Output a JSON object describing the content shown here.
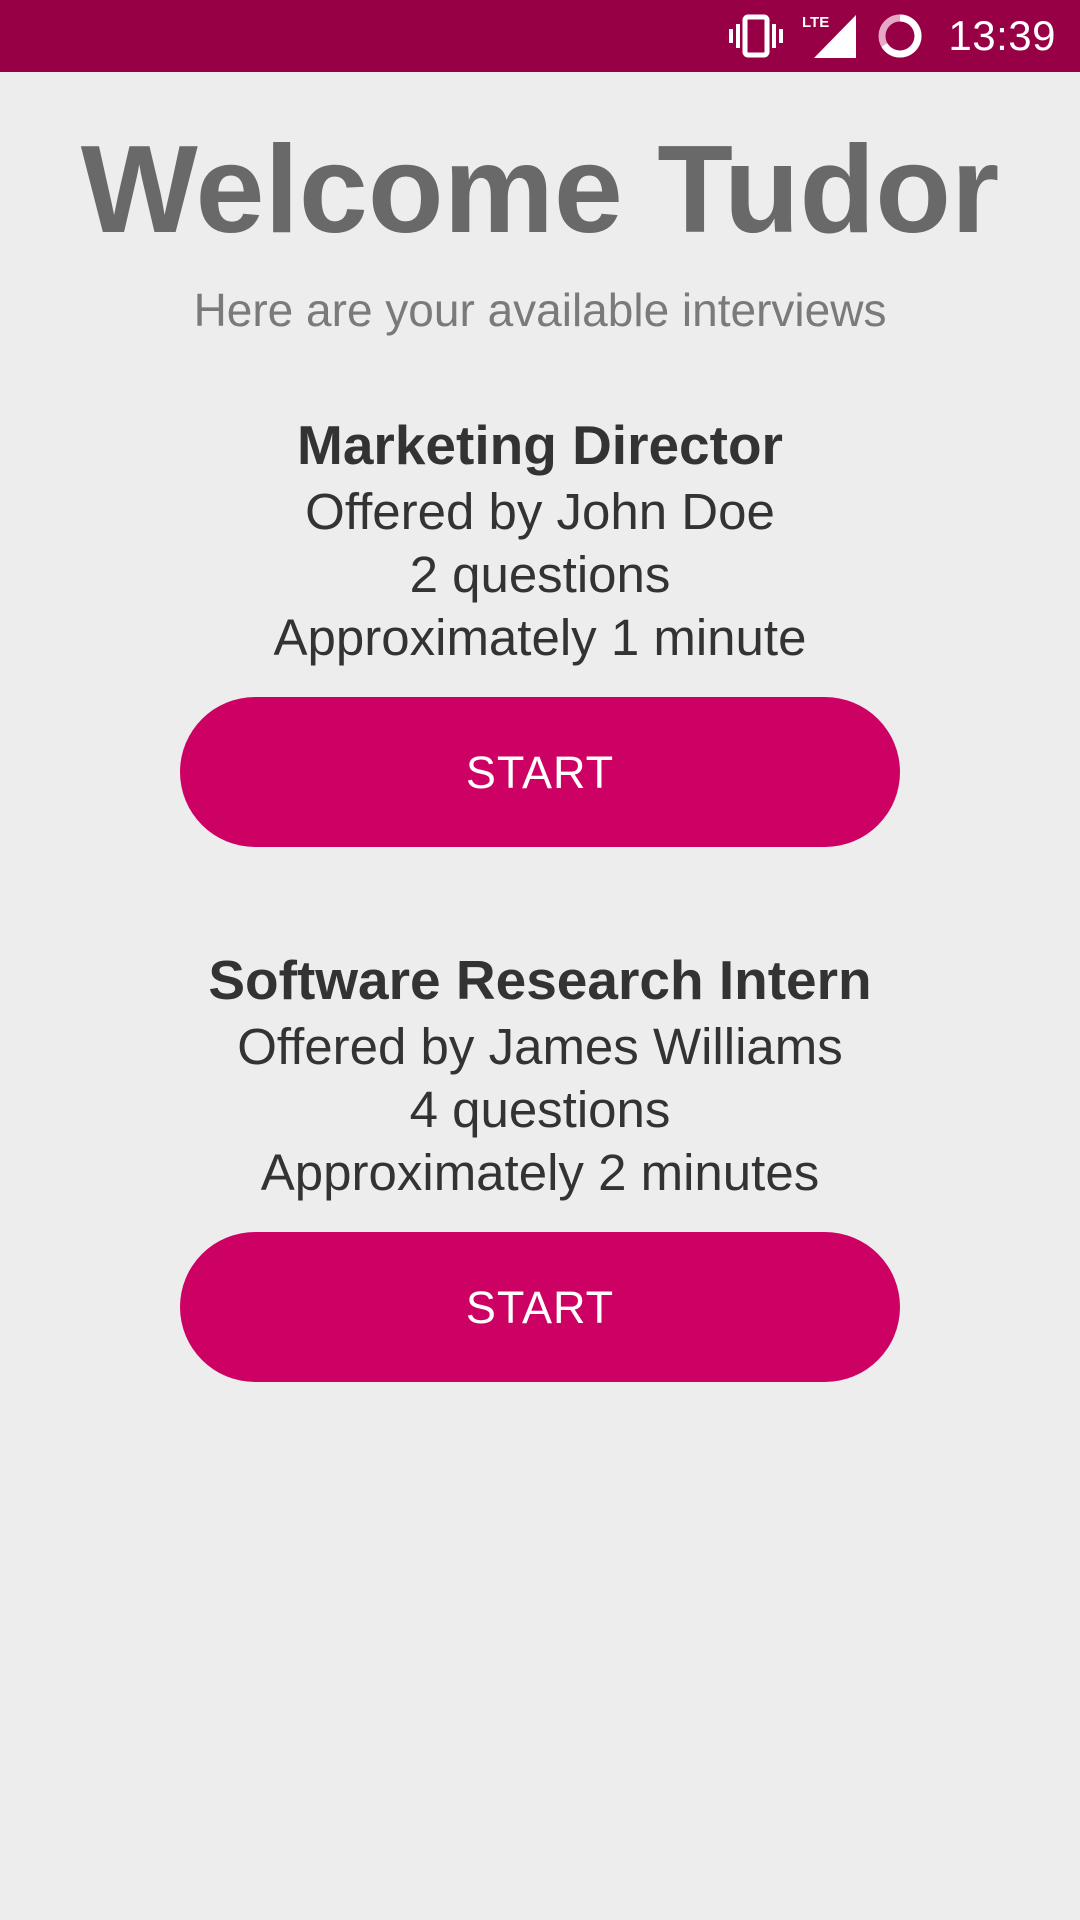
{
  "status_bar": {
    "time": "13:39",
    "network_label": "LTE",
    "icons": [
      "vibrate-icon",
      "lte-signal-icon",
      "sync-loading-icon"
    ],
    "color": "#970045"
  },
  "header": {
    "title": "Welcome Tudor",
    "subtitle": "Here are your available interviews"
  },
  "interviews": [
    {
      "title": "Marketing Director",
      "offered_by": "Offered by John Doe",
      "questions": "2 questions",
      "duration": "Approximately 1 minute",
      "button_label": "START"
    },
    {
      "title": "Software Research Intern",
      "offered_by": "Offered by James Williams",
      "questions": "4 questions",
      "duration": "Approximately 2 minutes",
      "button_label": "START"
    }
  ],
  "colors": {
    "background": "#EEEDEE",
    "accent": "#CD0063",
    "title_text": "#696969",
    "body_text": "#333333"
  }
}
